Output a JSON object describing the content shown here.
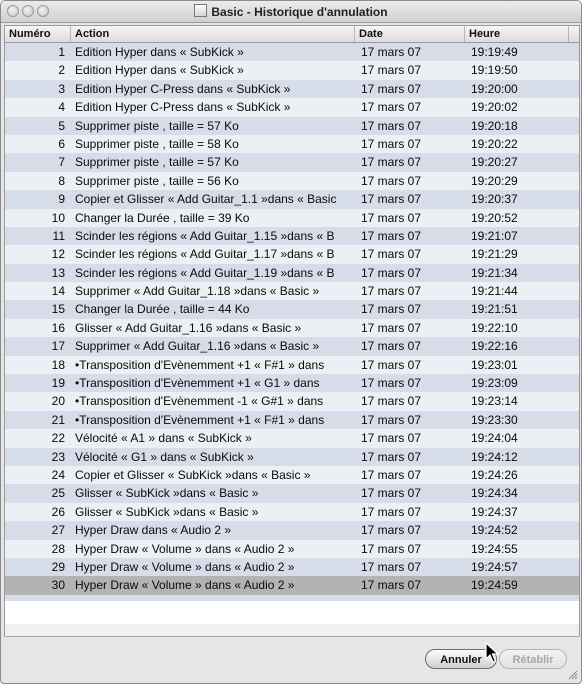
{
  "window": {
    "title": "Basic - Historique d'annulation"
  },
  "table": {
    "columns": {
      "numero": "Numéro",
      "action": "Action",
      "date": "Date",
      "heure": "Heure"
    },
    "rows": [
      {
        "num": "1",
        "action": "Edition Hyper dans « SubKick »",
        "date": "17 mars 07",
        "heure": "19:19:49"
      },
      {
        "num": "2",
        "action": "Edition Hyper dans « SubKick »",
        "date": "17 mars 07",
        "heure": "19:19:50"
      },
      {
        "num": "3",
        "action": "Edition Hyper C-Press dans « SubKick »",
        "date": "17 mars 07",
        "heure": "19:20:00"
      },
      {
        "num": "4",
        "action": "Edition Hyper C-Press dans « SubKick »",
        "date": "17 mars 07",
        "heure": "19:20:02"
      },
      {
        "num": "5",
        "action": "Supprimer piste , taille = 57 Ko",
        "date": "17 mars 07",
        "heure": "19:20:18"
      },
      {
        "num": "6",
        "action": "Supprimer piste , taille = 58 Ko",
        "date": "17 mars 07",
        "heure": "19:20:22"
      },
      {
        "num": "7",
        "action": "Supprimer piste , taille = 57 Ko",
        "date": "17 mars 07",
        "heure": "19:20:27"
      },
      {
        "num": "8",
        "action": "Supprimer piste , taille = 56 Ko",
        "date": "17 mars 07",
        "heure": "19:20:29"
      },
      {
        "num": "9",
        "action": "Copier et Glisser « Add Guitar_1.1 »dans « Basic",
        "date": "17 mars 07",
        "heure": "19:20:37"
      },
      {
        "num": "10",
        "action": "Changer la Durée , taille = 39 Ko",
        "date": "17 mars 07",
        "heure": "19:20:52"
      },
      {
        "num": "11",
        "action": "Scinder les régions « Add Guitar_1.15 »dans « B",
        "date": "17 mars 07",
        "heure": "19:21:07"
      },
      {
        "num": "12",
        "action": "Scinder les régions « Add Guitar_1.17 »dans « B",
        "date": "17 mars 07",
        "heure": "19:21:29"
      },
      {
        "num": "13",
        "action": "Scinder les régions « Add Guitar_1.19 »dans « B",
        "date": "17 mars 07",
        "heure": "19:21:34"
      },
      {
        "num": "14",
        "action": "Supprimer « Add Guitar_1.18 »dans « Basic »",
        "date": "17 mars 07",
        "heure": "19:21:44"
      },
      {
        "num": "15",
        "action": "Changer la Durée , taille = 44 Ko",
        "date": "17 mars 07",
        "heure": "19:21:51"
      },
      {
        "num": "16",
        "action": "Glisser « Add Guitar_1.16 »dans « Basic »",
        "date": "17 mars 07",
        "heure": "19:22:10"
      },
      {
        "num": "17",
        "action": "Supprimer « Add Guitar_1.16 »dans « Basic »",
        "date": "17 mars 07",
        "heure": "19:22:16"
      },
      {
        "num": "18",
        "action": "•Transposition d'Evènemment +1 « F#1 » dans",
        "date": "17 mars 07",
        "heure": "19:23:01"
      },
      {
        "num": "19",
        "action": "•Transposition d'Evènemment +1 « G1 » dans",
        "date": "17 mars 07",
        "heure": "19:23:09"
      },
      {
        "num": "20",
        "action": "•Transposition d'Evènemment -1 « G#1 » dans",
        "date": "17 mars 07",
        "heure": "19:23:14"
      },
      {
        "num": "21",
        "action": "•Transposition d'Evènemment +1 « F#1 » dans",
        "date": "17 mars 07",
        "heure": "19:23:30"
      },
      {
        "num": "22",
        "action": "Vélocité « A1 » dans « SubKick »",
        "date": "17 mars 07",
        "heure": "19:24:04"
      },
      {
        "num": "23",
        "action": "Vélocité « G1 » dans « SubKick »",
        "date": "17 mars 07",
        "heure": "19:24:12"
      },
      {
        "num": "24",
        "action": "Copier et Glisser « SubKick »dans « Basic »",
        "date": "17 mars 07",
        "heure": "19:24:26"
      },
      {
        "num": "25",
        "action": "Glisser « SubKick »dans « Basic »",
        "date": "17 mars 07",
        "heure": "19:24:34"
      },
      {
        "num": "26",
        "action": "Glisser « SubKick »dans « Basic »",
        "date": "17 mars 07",
        "heure": "19:24:37"
      },
      {
        "num": "27",
        "action": "Hyper Draw dans « Audio 2 »",
        "date": "17 mars 07",
        "heure": "19:24:52"
      },
      {
        "num": "28",
        "action": "Hyper Draw « Volume » dans « Audio 2 »",
        "date": "17 mars 07",
        "heure": "19:24:55"
      },
      {
        "num": "29",
        "action": "Hyper Draw « Volume » dans « Audio 2 »",
        "date": "17 mars 07",
        "heure": "19:24:57"
      },
      {
        "num": "30",
        "action": "Hyper Draw « Volume » dans « Audio 2 »",
        "date": "17 mars 07",
        "heure": "19:24:59"
      }
    ],
    "selected_row": "30"
  },
  "buttons": {
    "annuler": "Annuler",
    "retablir": "Rétablir"
  },
  "icons": {
    "traffic_lights": "window-control-icon",
    "document": "document-icon",
    "cursor": "arrow-cursor-icon",
    "resize": "resize-grip-icon"
  }
}
